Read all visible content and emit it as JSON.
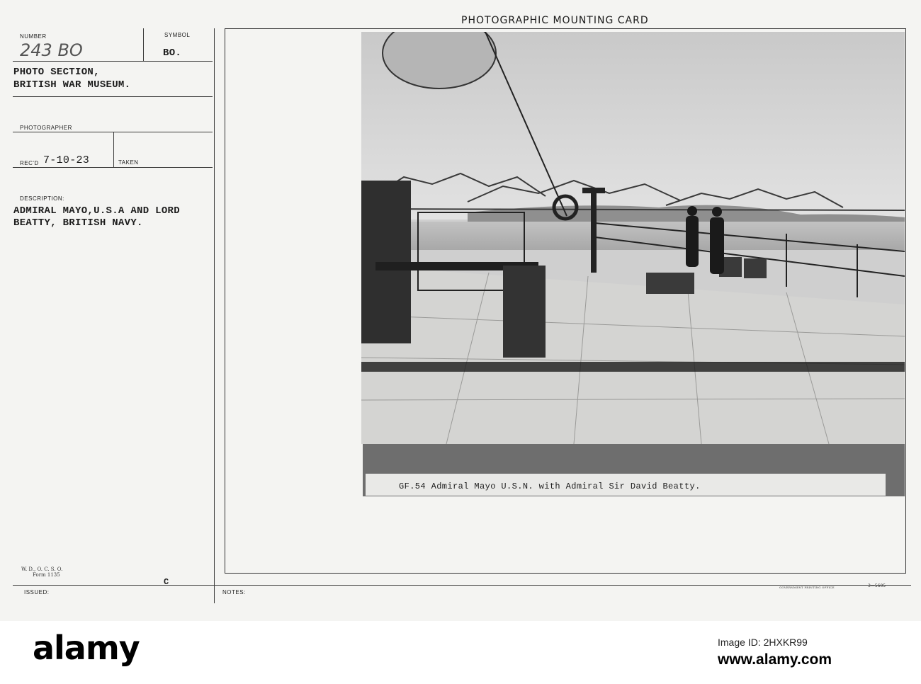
{
  "card": {
    "title": "PHOTOGRAPHIC MOUNTING CARD",
    "number_label": "NUMBER",
    "number_value": "243 BO",
    "symbol_label": "SYMBOL",
    "symbol_value": "BO.",
    "section_line1": "PHOTO SECTION,",
    "section_line2": "BRITISH WAR MUSEUM.",
    "photographer_label": "PHOTOGRAPHER",
    "recd_label": "REC'D",
    "recd_value": "7-10-23",
    "taken_label": "TAKEN",
    "description_label": "DESCRIPTION:",
    "description_line1": "ADMIRAL MAYO,U.S.A AND LORD",
    "description_line2": "BEATTY, BRITISH NAVY.",
    "form_line1": "W. D., O. C. S. O.",
    "form_line2": "Form 1135",
    "c_mark": "C",
    "issued_label": "ISSUED:",
    "notes_label": "NOTES:",
    "gpo_text": "GOVERNMENT PRINTING OFFICE",
    "print_code": "3—5605"
  },
  "photo": {
    "caption": "GF.54   Admiral Mayo U.S.N. with Admiral Sir David Beatty."
  },
  "watermark": {
    "logo": "alamy",
    "image_id": "Image ID: 2HXKR99",
    "url": "www.alamy.com"
  }
}
